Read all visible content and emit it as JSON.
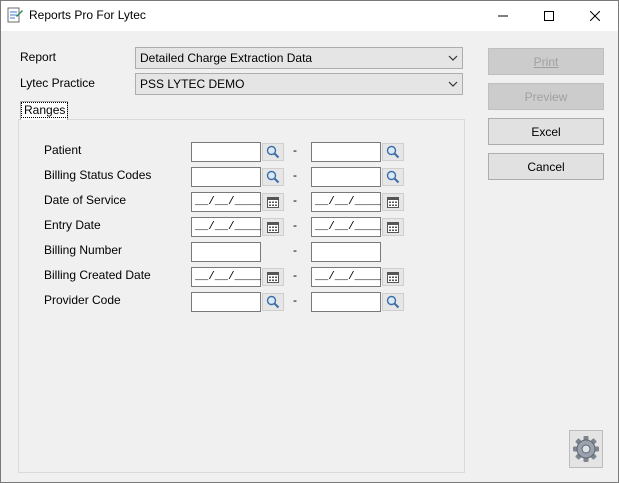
{
  "window": {
    "title": "Reports Pro For Lytec"
  },
  "form": {
    "report_label": "Report",
    "report_value": "Detailed Charge Extraction Data",
    "practice_label": "Lytec Practice",
    "practice_value": "PSS LYTEC DEMO"
  },
  "buttons": {
    "print": "Print",
    "preview": "Preview",
    "excel": "Excel",
    "cancel": "Cancel"
  },
  "tab": {
    "label": "Ranges"
  },
  "ranges": {
    "separator": "-",
    "rows": [
      {
        "label": "Patient",
        "type": "lookup",
        "from": "",
        "to": ""
      },
      {
        "label": "Billing Status Codes",
        "type": "lookup",
        "from": "",
        "to": ""
      },
      {
        "label": "Date of Service",
        "type": "date",
        "from": "__/__/____",
        "to": "__/__/____"
      },
      {
        "label": "Entry Date",
        "type": "date",
        "from": "__/__/____",
        "to": "__/__/____"
      },
      {
        "label": "Billing Number",
        "type": "text",
        "from": "",
        "to": ""
      },
      {
        "label": "Billing Created Date",
        "type": "date",
        "from": "__/__/____",
        "to": "__/__/____"
      },
      {
        "label": "Provider Code",
        "type": "lookup",
        "from": "",
        "to": ""
      }
    ]
  },
  "icons": {
    "lookup": "magnifier-icon",
    "date": "calendar-icon",
    "settings": "gear-icon"
  },
  "colors": {
    "window_bg": "#f0f0f0",
    "disabled_text": "#a0a0a0"
  }
}
